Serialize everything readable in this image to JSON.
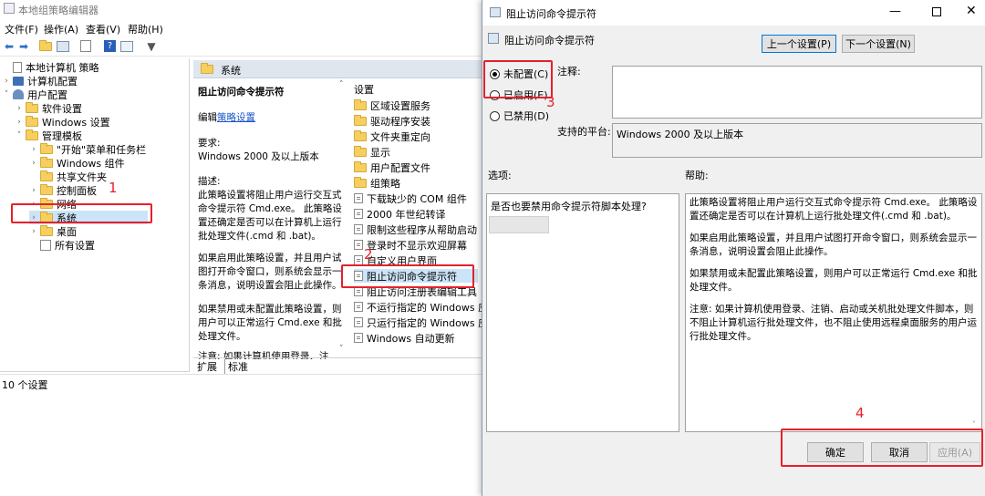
{
  "main_window": {
    "title": "本地组策略编辑器",
    "menu": [
      "文件(F)",
      "操作(A)",
      "查看(V)",
      "帮助(H)"
    ],
    "tree": [
      {
        "label": "本地计算机 策略",
        "level": 0,
        "arrow": "",
        "icon": "computer-policy-icon"
      },
      {
        "label": "计算机配置",
        "level": 1,
        "arrow": "›",
        "icon": "computer-icon"
      },
      {
        "label": "用户配置",
        "level": 1,
        "arrow": "˅",
        "icon": "users-icon"
      },
      {
        "label": "软件设置",
        "level": 2,
        "arrow": "›",
        "icon": "folder-icon"
      },
      {
        "label": "Windows 设置",
        "level": 2,
        "arrow": "›",
        "icon": "folder-icon"
      },
      {
        "label": "管理模板",
        "level": 2,
        "arrow": "˅",
        "icon": "folder-icon"
      },
      {
        "label": "\"开始\"菜单和任务栏",
        "level": 3,
        "arrow": "›",
        "icon": "folder-icon"
      },
      {
        "label": "Windows 组件",
        "level": 3,
        "arrow": "›",
        "icon": "folder-icon"
      },
      {
        "label": "共享文件夹",
        "level": 3,
        "arrow": "",
        "icon": "folder-icon"
      },
      {
        "label": "控制面板",
        "level": 3,
        "arrow": "›",
        "icon": "folder-icon"
      },
      {
        "label": "网络",
        "level": 3,
        "arrow": "›",
        "icon": "folder-icon"
      },
      {
        "label": "系统",
        "level": 3,
        "arrow": "›",
        "icon": "folder-icon"
      },
      {
        "label": "桌面",
        "level": 3,
        "arrow": "›",
        "icon": "folder-icon"
      },
      {
        "label": "所有设置",
        "level": 3,
        "arrow": "",
        "icon": "all-settings-icon"
      }
    ],
    "pane_header": "系统",
    "description": {
      "title": "阻止访问命令提示符",
      "edit_prefix": "编辑",
      "edit_link": "策略设置",
      "req_label": "要求:",
      "req_value": "Windows 2000 及以上版本",
      "desc_label": "描述:",
      "desc_text": "此策略设置将阻止用户运行交互式命令提示符 Cmd.exe。 此策略设置还确定是否可以在计算机上运行批处理文件(.cmd 和 .bat)。",
      "desc_enabled": "如果启用此策略设置，并且用户试图打开命令窗口，则系统会显示一条消息，说明设置会阻止此操作。",
      "desc_disabled": "如果禁用或未配置此策略设置，则用户可以正常运行 Cmd.exe 和批处理文件。",
      "desc_note_cut": "注意: 如果计算机使用登录、注"
    },
    "settings_header": "设置",
    "settings": [
      {
        "label": "区域设置服务",
        "type": "folder"
      },
      {
        "label": "驱动程序安装",
        "type": "folder"
      },
      {
        "label": "文件夹重定向",
        "type": "folder"
      },
      {
        "label": "显示",
        "type": "folder"
      },
      {
        "label": "用户配置文件",
        "type": "folder"
      },
      {
        "label": "组策略",
        "type": "folder"
      },
      {
        "label": "下载缺少的 COM 组件",
        "type": "policy"
      },
      {
        "label": "2000 年世纪转译",
        "type": "policy"
      },
      {
        "label": "限制这些程序从帮助启动",
        "type": "policy"
      },
      {
        "label": "登录时不显示欢迎屏幕",
        "type": "policy"
      },
      {
        "label": "自定义用户界面",
        "type": "policy"
      },
      {
        "label": "阻止访问命令提示符",
        "type": "policy"
      },
      {
        "label": "阻止访问注册表编辑工具",
        "type": "policy"
      },
      {
        "label": "不运行指定的 Windows 应用",
        "type": "policy"
      },
      {
        "label": "只运行指定的 Windows 应用",
        "type": "policy"
      },
      {
        "label": "Windows 自动更新",
        "type": "policy"
      }
    ],
    "tabs": [
      "扩展",
      "标准"
    ],
    "status": "10 个设置"
  },
  "dialog": {
    "title": "阻止访问命令提示符",
    "policy_name": "阻止访问命令提示符",
    "prev_button": "上一个设置(P)",
    "next_button": "下一个设置(N)",
    "radio_not_configured": "未配置(C)",
    "radio_enabled": "已启用(E)",
    "radio_disabled": "已禁用(D)",
    "comment_label": "注释:",
    "platform_label": "支持的平台:",
    "platform_value": "Windows 2000 及以上版本",
    "options_label": "选项:",
    "help_label": "帮助:",
    "option_question": "是否也要禁用命令提示符脚本处理?",
    "help": [
      "此策略设置将阻止用户运行交互式命令提示符 Cmd.exe。 此策略设置还确定是否可以在计算机上运行批处理文件(.cmd 和 .bat)。",
      "如果启用此策略设置，并且用户试图打开命令窗口，则系统会显示一条消息，说明设置会阻止此操作。",
      "如果禁用或未配置此策略设置，则用户可以正常运行 Cmd.exe 和批处理文件。",
      "注意: 如果计算机使用登录、注销、启动或关机批处理文件脚本，则不阻止计算机运行批处理文件，也不阻止使用远程桌面服务的用户运行批处理文件。"
    ],
    "ok_button": "确定",
    "cancel_button": "取消",
    "apply_button": "应用(A)",
    "selected_radio": "not_configured"
  },
  "annotations": [
    "1",
    "2",
    "3",
    "4"
  ],
  "colors": {
    "annotation_red": "#e6202a",
    "folder_yellow": "#f5cf5f",
    "header_blue": "#dfe6ee"
  }
}
